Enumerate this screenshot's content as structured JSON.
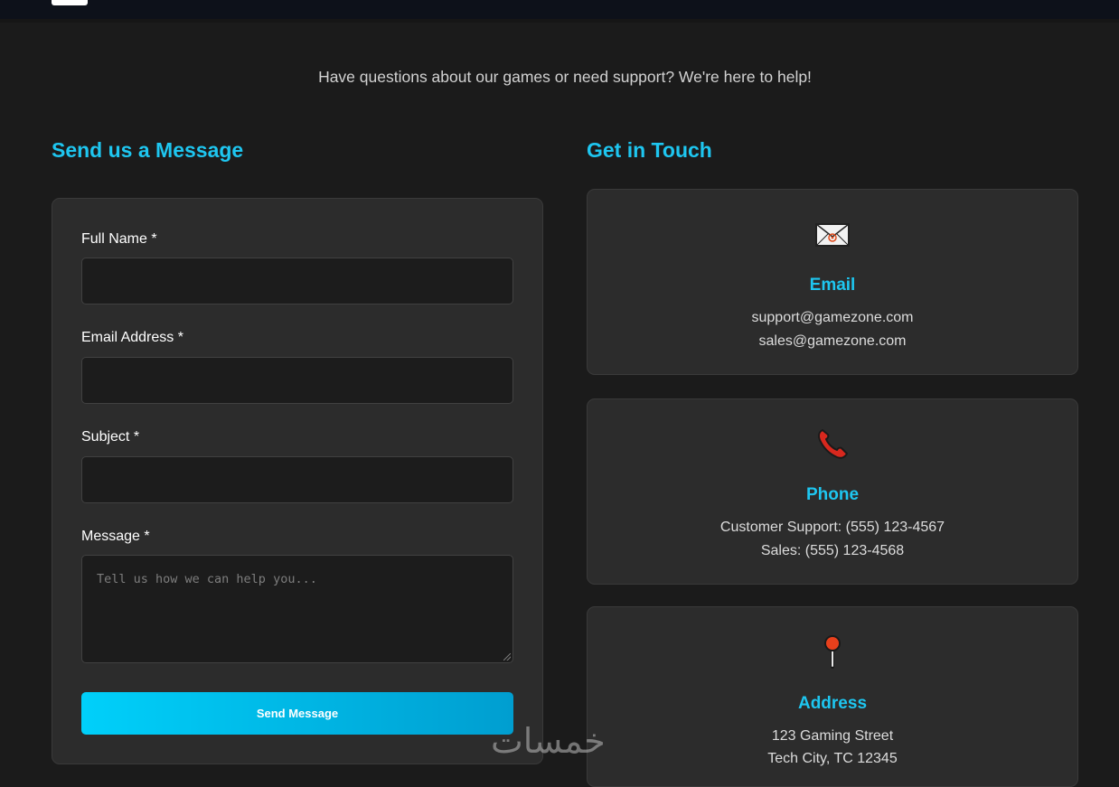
{
  "intro": "Have questions about our games or need support? We're here to help!",
  "form": {
    "title": "Send us a Message",
    "full_name_label": "Full Name *",
    "email_label": "Email Address *",
    "subject_label": "Subject *",
    "message_label": "Message *",
    "message_placeholder": "Tell us how we can help you...",
    "submit_label": "Send Message"
  },
  "contact": {
    "title": "Get in Touch",
    "email": {
      "title": "Email",
      "line1": "support@gamezone.com",
      "line2": "sales@gamezone.com",
      "icon": "envelope-icon"
    },
    "phone": {
      "title": "Phone",
      "line1": "Customer Support: (555) 123-4567",
      "line2": "Sales: (555) 123-4568",
      "icon": "phone-icon"
    },
    "address": {
      "title": "Address",
      "line1": "123 Gaming Street",
      "line2": "Tech City, TC 12345",
      "icon": "pin-icon"
    }
  },
  "watermark": "خمسات",
  "colors": {
    "accent": "#1ec6f0",
    "button_start": "#00d0fa",
    "button_end": "#009ed0",
    "background": "#1b1b1b",
    "panel": "#2c2c2c"
  }
}
